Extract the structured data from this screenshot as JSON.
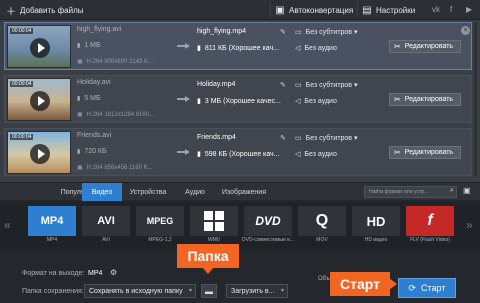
{
  "toolbar": {
    "add_files_label": "Добавить файлы",
    "autoconversion_label": "Автоконвертация",
    "settings_label": "Настройки",
    "social": [
      "vk",
      "f",
      "▶"
    ]
  },
  "files": [
    {
      "duration": "00:00:04",
      "source_name": "high_flying.avi",
      "source_size": "1 МБ",
      "source_info": "H.264 900x600 2143 K...",
      "output_name": "high_flying.mp4",
      "output_size": "811 КБ (Хорошее кач...",
      "subtitles": "Без субтитров",
      "audio": "Без аудио",
      "edit_label": "Редактировать"
    },
    {
      "duration": "00:00:04",
      "source_name": "Holiday.avi",
      "source_size": "5 МБ",
      "source_info": "H.264 1812x1284 9160...",
      "output_name": "Holiday.mp4",
      "output_size": "3 МБ (Хорошее качес...",
      "subtitles": "Без субтитров",
      "audio": "Без аудио",
      "edit_label": "Редактировать"
    },
    {
      "duration": "00:00:04",
      "source_name": "Friends.avi",
      "source_size": "720 КБ",
      "source_info": "H.264 656x456 1160 K...",
      "output_name": "Friends.mp4",
      "output_size": "598 КБ (Хорошее кач...",
      "subtitles": "Без субтитров",
      "audio": "Без аудио",
      "edit_label": "Редактировать"
    }
  ],
  "tabs": [
    {
      "label": "Популярные",
      "active": false
    },
    {
      "label": "Видео",
      "active": true
    },
    {
      "label": "Устройства",
      "active": false
    },
    {
      "label": "Аудио",
      "active": false
    },
    {
      "label": "Изображения",
      "active": false
    }
  ],
  "search_placeholder": "Найти формат или устр...",
  "formats": [
    {
      "logo": "MP4",
      "caption": "MP4",
      "selected": true
    },
    {
      "logo": "AVI",
      "caption": "AVI",
      "selected": false
    },
    {
      "logo": "MPEG",
      "caption": "MPEG-1,2",
      "selected": false
    },
    {
      "logo": "WMV",
      "caption": "WMV",
      "selected": false
    },
    {
      "logo": "DVD",
      "caption": "DVD-совместимые в...",
      "selected": false
    },
    {
      "logo": "Q",
      "caption": "MOV",
      "selected": false
    },
    {
      "logo": "HD",
      "caption": "HD видео",
      "selected": false
    },
    {
      "logo": "f",
      "caption": "FLV (Flash Video)",
      "selected": false
    }
  ],
  "bottom": {
    "output_format_label": "Формат на выходе:",
    "output_format_value": "MP4",
    "save_folder_label": "Папка сохранения:",
    "save_folder_value": "Сохранять в исходную папку",
    "upload_label": "Загрузить в...",
    "merge_text": "Объединить",
    "start_label": "Старт"
  },
  "callouts": {
    "folder": "Папка",
    "start": "Старт"
  },
  "colors": {
    "accent": "#2f7fd0",
    "callout": "#f26522"
  }
}
